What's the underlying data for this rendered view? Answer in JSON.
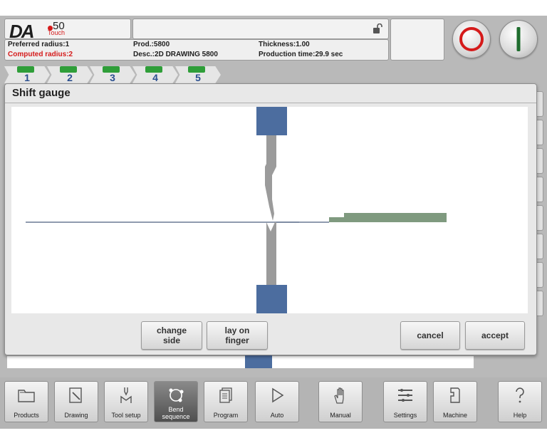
{
  "header": {
    "logo": {
      "brand": "DA",
      "model": "50",
      "edition": "Touch"
    },
    "info": {
      "preferred_radius": "Preferred radius:1",
      "computed_radius": "Computed radius:2",
      "prod": "Prod.:5800",
      "desc": "Desc.:2D DRAWING 5800",
      "thickness": "Thickness:1.00",
      "production_time": "Production time:29.9 sec"
    }
  },
  "steps": [
    {
      "label": "1"
    },
    {
      "label": "2"
    },
    {
      "label": "3"
    },
    {
      "label": "4"
    },
    {
      "label": "5"
    }
  ],
  "dialog": {
    "title": "Shift gauge",
    "buttons": {
      "change_side": "change\nside",
      "lay_on_finger": "lay on\nfinger",
      "cancel": "cancel",
      "accept": "accept"
    }
  },
  "colors": {
    "tool_blue": "#4c6d9f",
    "tool_grey": "#9b9b9b",
    "sheet_green": "#7f9a7f",
    "stop_red": "#d51b1b",
    "start_green": "#1f6d2e",
    "step_icon_green": "#2f9e39"
  },
  "toolbar": [
    {
      "label": "Products",
      "icon": "folder-icon"
    },
    {
      "label": "Drawing",
      "icon": "drawing-icon"
    },
    {
      "label": "Tool setup",
      "icon": "tool-setup-icon"
    },
    {
      "label": "Bend sequence",
      "icon": "bend-sequence-icon",
      "active": true
    },
    {
      "label": "Program",
      "icon": "program-icon"
    },
    {
      "label": "Auto",
      "icon": "play-icon"
    },
    {
      "label": "Manual",
      "icon": "hand-icon"
    },
    {
      "label": "Settings",
      "icon": "settings-icon"
    },
    {
      "label": "Machine",
      "icon": "machine-icon"
    },
    {
      "label": "Help",
      "icon": "help-icon"
    }
  ]
}
